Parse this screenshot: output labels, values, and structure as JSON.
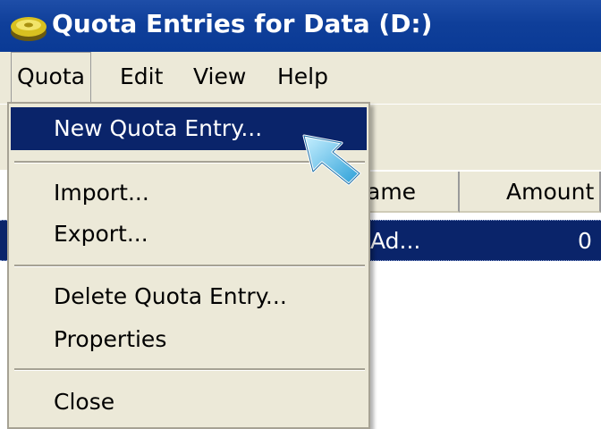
{
  "window": {
    "title": "Quota Entries for Data (D:)"
  },
  "menubar": {
    "items": [
      "Quota",
      "Edit",
      "View",
      "Help"
    ]
  },
  "quota_menu": {
    "items": [
      "New Quota Entry...",
      "Import...",
      "Export...",
      "Delete Quota Entry...",
      "Properties",
      "Close"
    ],
    "highlighted": "New Quota Entry..."
  },
  "list": {
    "columns": [
      "ame",
      "Amount"
    ],
    "rows": [
      {
        "name": "Ad...",
        "amount": "0"
      }
    ]
  },
  "colors": {
    "selection": "#0a246a",
    "titlebar": "#0f3f9a",
    "face": "#ece9d8"
  },
  "icons": {
    "title": "disk-icon",
    "cursor": "arrow-cursor-icon"
  }
}
